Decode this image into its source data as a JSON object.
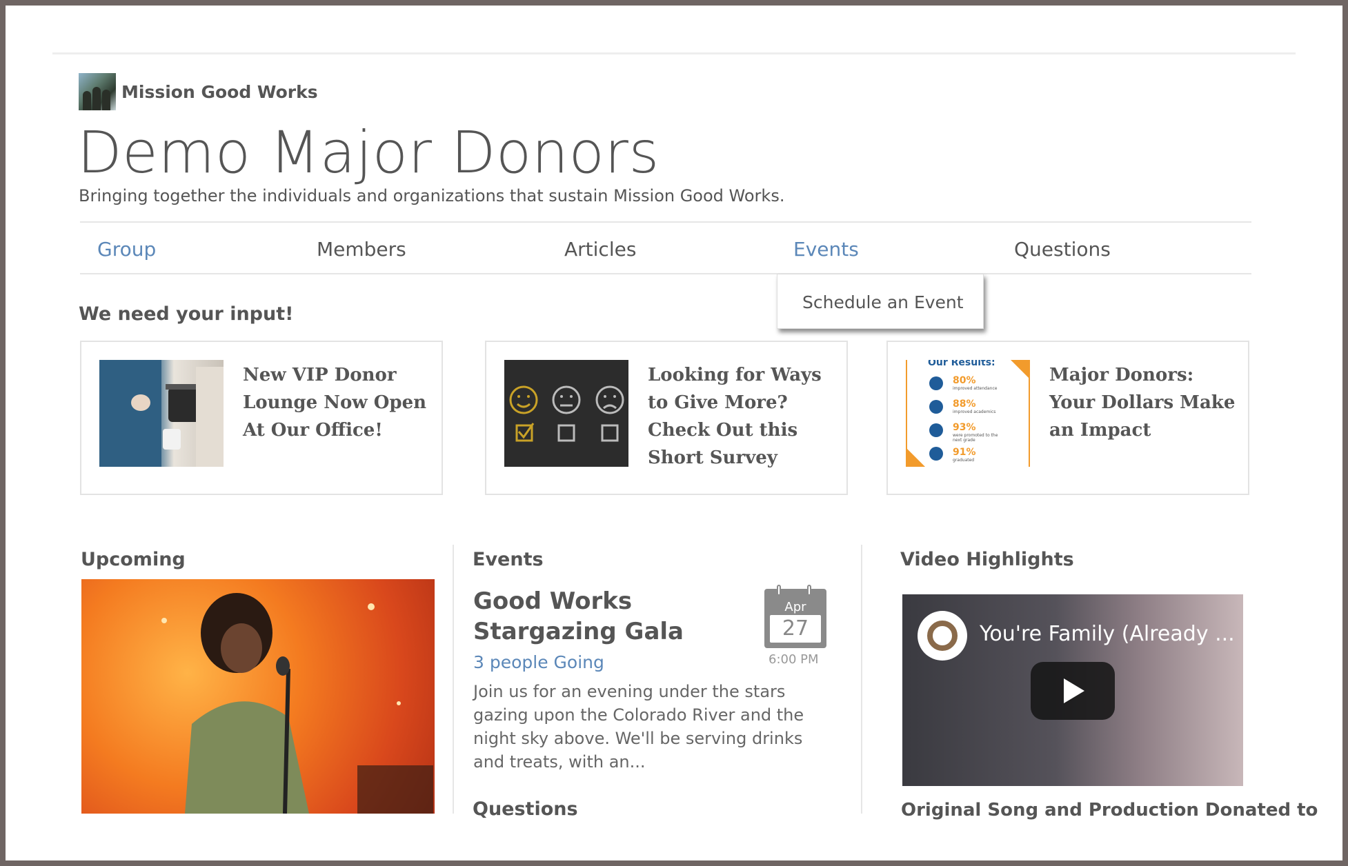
{
  "brand": {
    "name": "Mission Good Works",
    "logo_icon": "group-photo-icon"
  },
  "header": {
    "title": "Demo Major Donors",
    "subtitle": "Bringing together the individuals and organizations that sustain Mission Good Works."
  },
  "nav": {
    "items": [
      {
        "label": "Group",
        "active": true
      },
      {
        "label": "Members",
        "active": false
      },
      {
        "label": "Articles",
        "active": false
      },
      {
        "label": "Events",
        "active": true
      },
      {
        "label": "Questions",
        "active": false
      }
    ],
    "dropdown": {
      "label": "Schedule an Event"
    }
  },
  "feature": {
    "heading": "We need your input!",
    "cards": [
      {
        "title": "New VIP Donor Lounge Now Open At Our Office!",
        "image_icon": "coffee-pour-photo"
      },
      {
        "title": "Looking for Ways to Give More? Check Out this Short Survey",
        "image_icon": "survey-faces-photo"
      },
      {
        "title": "Major Donors: Your Dollars Make an Impact",
        "image_icon": "results-infographic",
        "infographic": {
          "heading": "Our Results:",
          "rows": [
            {
              "value": "80%",
              "label": "improved attendance"
            },
            {
              "value": "88%",
              "label": "improved academics"
            },
            {
              "value": "93%",
              "label": "were promoted to the next grade"
            },
            {
              "value": "91%",
              "label": "graduated"
            }
          ]
        }
      }
    ]
  },
  "upcoming": {
    "heading": "Upcoming",
    "image_icon": "singer-performing-photo"
  },
  "events": {
    "heading": "Events",
    "item": {
      "title": "Good Works Stargazing Gala",
      "going": "3 people Going",
      "month": "Apr",
      "day": "27",
      "time": "6:00 PM",
      "description": "Join us for an evening under the stars gazing upon the Colorado River and the night sky above. We'll be serving drinks and treats, with an..."
    },
    "questions_heading": "Questions"
  },
  "video": {
    "heading": "Video Highlights",
    "title": "You're Family (Already ...",
    "caption": "Original Song and Production Donated to"
  },
  "colors": {
    "accent": "#5b87b8",
    "orange": "#f29b2c",
    "text": "#555555"
  }
}
